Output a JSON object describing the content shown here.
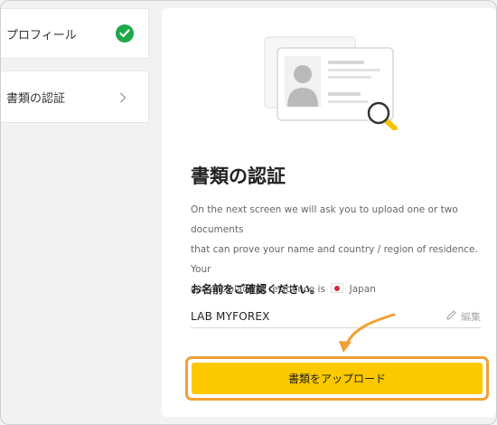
{
  "sidebar": {
    "items": [
      {
        "label": "プロフィール",
        "status": "complete"
      },
      {
        "label": "書類の認証",
        "status": "current"
      }
    ]
  },
  "main": {
    "title": "書類の認証",
    "description_line1": "On the next screen we will ask you to upload one or two documents",
    "description_line2": "that can prove your name and country / region of residence. Your",
    "description_line3": "current place of residence is",
    "residence_country": "Japan",
    "name_prompt": "お名前をご確認ください。",
    "name_value": "LAB MYFOREX",
    "edit_label": "編集",
    "upload_button": "書類をアップロード"
  },
  "colors": {
    "accent": "#fcc800",
    "highlight": "#f2a033",
    "success": "#1fa84a",
    "magnifier": "#f5c400"
  },
  "icons": [
    "check-icon",
    "chevron-right-icon",
    "id-card-icon",
    "magnifier-icon",
    "pencil-icon",
    "japan-flag-icon",
    "curved-arrow-icon"
  ]
}
